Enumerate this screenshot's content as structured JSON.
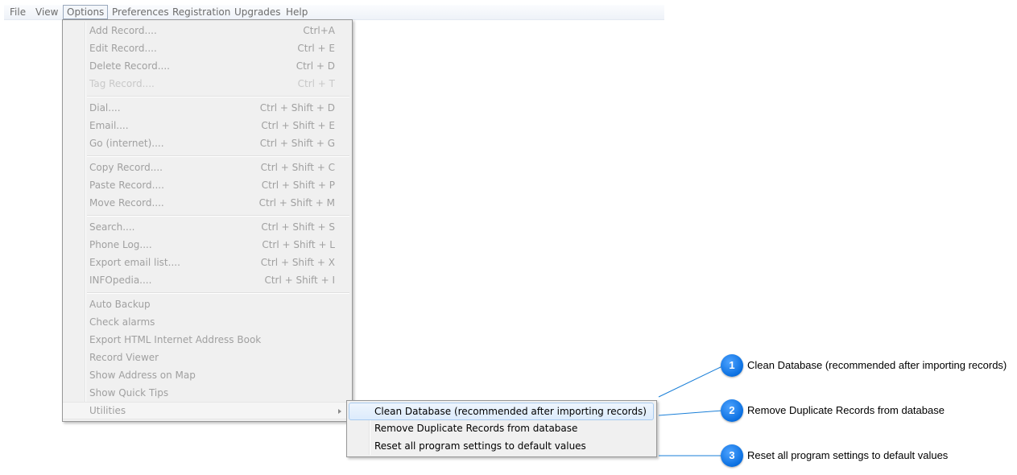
{
  "menubar": {
    "items": [
      "File",
      "View",
      "Options",
      "Preferences",
      "Registration",
      "Upgrades",
      "Help"
    ]
  },
  "options_menu": {
    "items": [
      {
        "label": "Add Record....",
        "shortcut": "Ctrl+A"
      },
      {
        "label": "Edit Record....",
        "shortcut": "Ctrl + E"
      },
      {
        "label": "Delete Record....",
        "shortcut": "Ctrl + D"
      },
      {
        "label": "Tag Record....",
        "shortcut": "Ctrl + T"
      },
      {
        "label": "Dial....",
        "shortcut": "Ctrl + Shift + D"
      },
      {
        "label": "Email....",
        "shortcut": "Ctrl + Shift + E"
      },
      {
        "label": "Go (internet)....",
        "shortcut": "Ctrl + Shift + G"
      },
      {
        "label": "Copy Record....",
        "shortcut": "Ctrl + Shift + C"
      },
      {
        "label": "Paste Record....",
        "shortcut": "Ctrl + Shift + P"
      },
      {
        "label": "Move Record....",
        "shortcut": "Ctrl + Shift + M"
      },
      {
        "label": "Search....",
        "shortcut": "Ctrl + Shift + S"
      },
      {
        "label": "Phone Log....",
        "shortcut": "Ctrl + Shift + L"
      },
      {
        "label": "Export email list....",
        "shortcut": "Ctrl + Shift + X"
      },
      {
        "label": "INFOpedia....",
        "shortcut": "Ctrl + Shift + I"
      },
      {
        "label": "Auto Backup",
        "shortcut": ""
      },
      {
        "label": "Check alarms",
        "shortcut": ""
      },
      {
        "label": "Export HTML Internet Address Book",
        "shortcut": ""
      },
      {
        "label": "Record Viewer",
        "shortcut": ""
      },
      {
        "label": "Show Address on Map",
        "shortcut": ""
      },
      {
        "label": "Show Quick Tips",
        "shortcut": ""
      },
      {
        "label": "Utilities",
        "shortcut": ""
      }
    ]
  },
  "utilities_submenu": {
    "items": [
      "Clean Database (recommended after importing records)",
      "Remove Duplicate Records from database",
      "Reset all program settings to default values"
    ]
  },
  "callouts": [
    {
      "number": "1",
      "text": "Clean Database (recommended after importing records)"
    },
    {
      "number": "2",
      "text": "Remove Duplicate Records from database"
    },
    {
      "number": "3",
      "text": "Reset all program settings to default values"
    }
  ],
  "colors": {
    "callout_badge": "#0a6fe0",
    "callout_line": "#1a7fd8",
    "disabled_text": "#a0a0a0",
    "submenu_highlight": "#dcebfc"
  }
}
